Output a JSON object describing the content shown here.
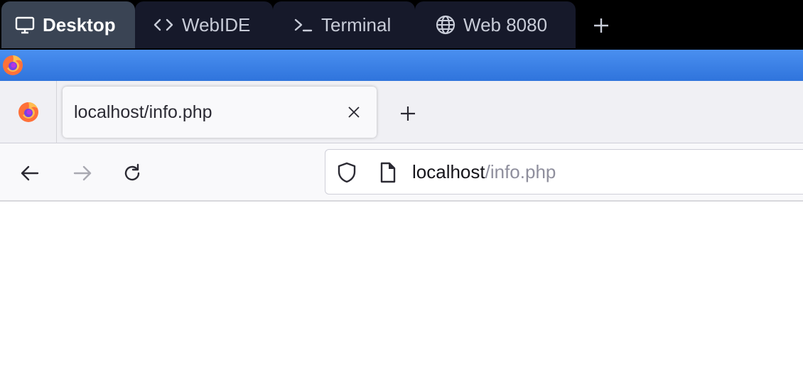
{
  "workspace_tabs": [
    {
      "label": "Desktop",
      "icon": "monitor-icon",
      "active": true
    },
    {
      "label": "WebIDE",
      "icon": "code-icon",
      "active": false
    },
    {
      "label": "Terminal",
      "icon": "terminal-prompt-icon",
      "active": false
    },
    {
      "label": "Web 8080",
      "icon": "globe-icon",
      "active": false
    }
  ],
  "browser": {
    "tab": {
      "title": "localhost/info.php"
    },
    "url": {
      "host": "localhost",
      "path": "/info.php"
    }
  },
  "colors": {
    "workspace_bar": "#000000",
    "workspace_tab_active": "#3a4454",
    "workspace_tab_inactive": "#16192a",
    "title_strip": "#3a82e6",
    "toolbar": "#f9f9fb"
  }
}
